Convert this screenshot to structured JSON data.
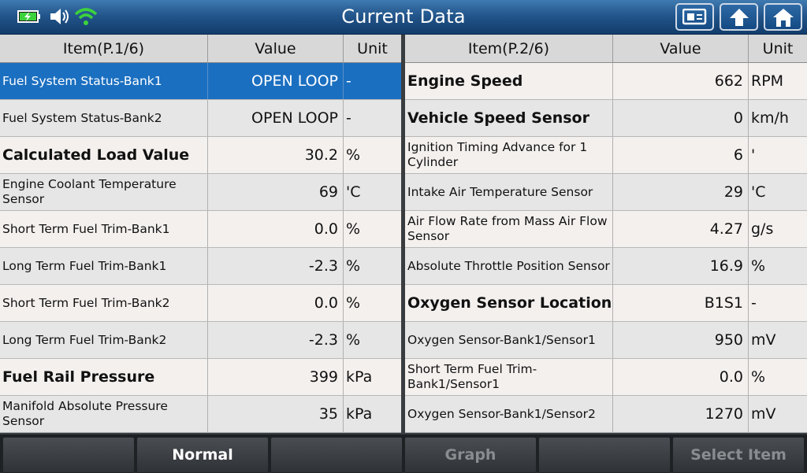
{
  "header": {
    "title": "Current Data"
  },
  "left_table": {
    "columns": [
      "Item(P.1/6)",
      "Value",
      "Unit"
    ],
    "rows": [
      {
        "item": "Fuel System Status-Bank1",
        "value": "OPEN LOOP",
        "unit": "-"
      },
      {
        "item": "Fuel System Status-Bank2",
        "value": "OPEN LOOP",
        "unit": "-"
      },
      {
        "item": "Calculated Load Value",
        "value": "30.2",
        "unit": "%"
      },
      {
        "item": "Engine Coolant Temperature Sensor",
        "value": "69",
        "unit": "'C"
      },
      {
        "item": "Short Term Fuel Trim-Bank1",
        "value": "0.0",
        "unit": "%"
      },
      {
        "item": "Long Term Fuel Trim-Bank1",
        "value": "-2.3",
        "unit": "%"
      },
      {
        "item": "Short Term Fuel Trim-Bank2",
        "value": "0.0",
        "unit": "%"
      },
      {
        "item": "Long Term Fuel Trim-Bank2",
        "value": "-2.3",
        "unit": "%"
      },
      {
        "item": "Fuel Rail Pressure",
        "value": "399",
        "unit": "kPa"
      },
      {
        "item": "Manifold Absolute Pressure Sensor",
        "value": "35",
        "unit": "kPa"
      }
    ]
  },
  "right_table": {
    "columns": [
      "Item(P.2/6)",
      "Value",
      "Unit"
    ],
    "rows": [
      {
        "item": "Engine Speed",
        "value": "662",
        "unit": "RPM"
      },
      {
        "item": "Vehicle Speed Sensor",
        "value": "0",
        "unit": "km/h"
      },
      {
        "item": "Ignition Timing Advance for 1 Cylinder",
        "value": "6",
        "unit": "'"
      },
      {
        "item": "Intake Air Temperature Sensor",
        "value": "29",
        "unit": "'C"
      },
      {
        "item": "Air Flow Rate from Mass Air Flow Sensor",
        "value": "4.27",
        "unit": "g/s"
      },
      {
        "item": "Absolute Throttle Position Sensor",
        "value": "16.9",
        "unit": "%"
      },
      {
        "item": "Oxygen Sensor Location",
        "value": "B1S1",
        "unit": "-"
      },
      {
        "item": "Oxygen Sensor-Bank1/Sensor1",
        "value": "950",
        "unit": "mV"
      },
      {
        "item": "Short Term Fuel Trim-Bank1/Sensor1",
        "value": "0.0",
        "unit": "%"
      },
      {
        "item": "Oxygen Sensor-Bank1/Sensor2",
        "value": "1270",
        "unit": "mV"
      }
    ]
  },
  "bottom_bar": {
    "buttons": [
      "",
      "Normal",
      "",
      "Graph",
      "",
      "Select Item"
    ]
  },
  "icons": {
    "battery": "battery-charging-icon",
    "volume": "speaker-icon",
    "wifi": "wifi-icon",
    "screenshot": "screen-capture-icon",
    "back": "up-arrow-icon",
    "home": "home-icon"
  },
  "colors": {
    "selected_row": "#1b6fc0",
    "title_bar": "#23568c"
  }
}
